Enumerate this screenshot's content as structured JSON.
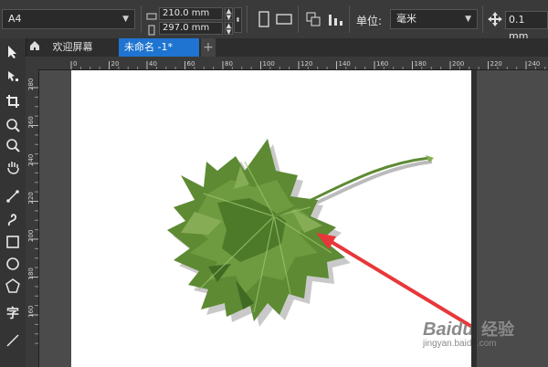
{
  "propbar": {
    "page_size": "A4",
    "width_value": "210.0 mm",
    "height_value": "297.0 mm",
    "units_label": "单位:",
    "units_value": "毫米",
    "nudge_value": "0.1 mm"
  },
  "tabs": [
    {
      "label": "欢迎屏幕"
    },
    {
      "label": "未命名 -1*"
    }
  ],
  "ruler": {
    "h_ticks": [
      "0",
      "20",
      "40",
      "60",
      "80",
      "100",
      "120",
      "140",
      "160",
      "180",
      "200",
      "220",
      "240"
    ],
    "v_ticks": [
      "280",
      "260",
      "240",
      "220",
      "200",
      "180",
      "160"
    ]
  },
  "toolbox": {
    "items": [
      "pick-tool",
      "node-tool",
      "crop-tool",
      "zoom-tool",
      "pan-tool",
      "freehand-tool",
      "artistic-media-tool",
      "rectangle-tool",
      "ellipse-tool",
      "polygon-tool",
      "text-tool",
      "line-tool"
    ],
    "text_tool_glyph": "字"
  },
  "watermark": {
    "brand": "Baidu",
    "brand_cn": "经验",
    "url": "jingyan.baidu.com"
  },
  "colors": {
    "accent_tab": "#1e74d0",
    "arrow": "#e8373a",
    "leaf_dark": "#3f6b24",
    "leaf_mid": "#5d8a33",
    "leaf_light": "#86ad55"
  }
}
